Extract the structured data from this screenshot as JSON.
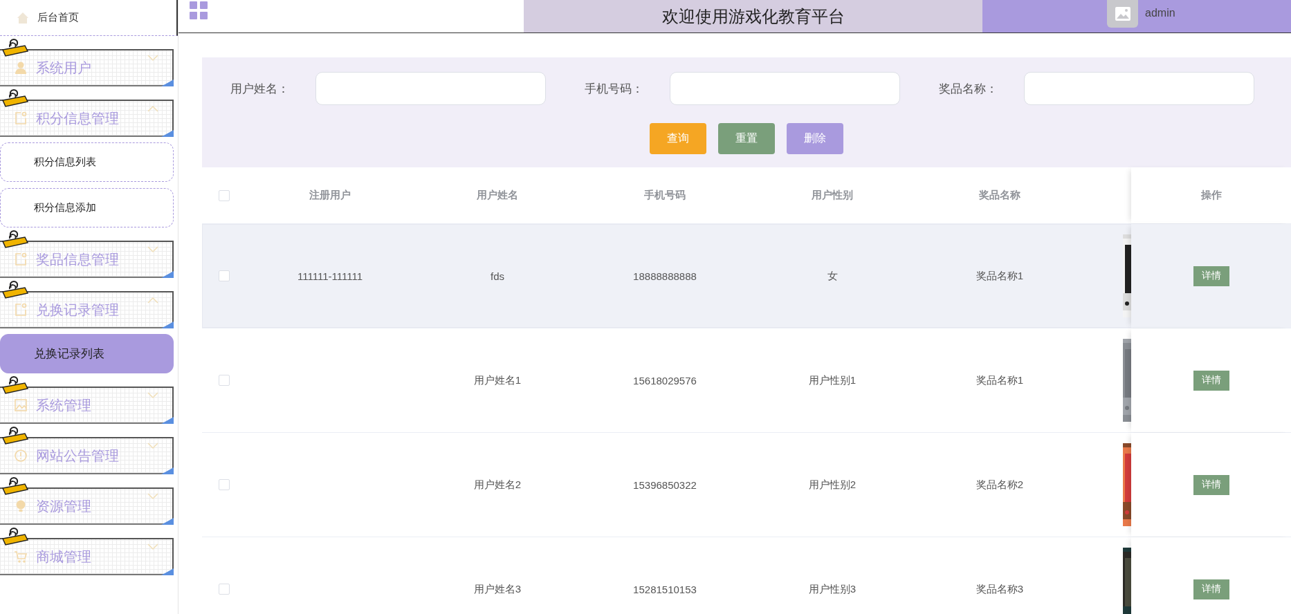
{
  "sidebar": {
    "home": {
      "label": "后台首页"
    },
    "groups": [
      {
        "label": "系统用户",
        "expanded": false
      },
      {
        "label": "积分信息管理",
        "expanded": true,
        "children": [
          {
            "label": "积分信息列表",
            "selected": false
          },
          {
            "label": "积分信息添加",
            "selected": false
          }
        ]
      },
      {
        "label": "奖品信息管理",
        "expanded": false
      },
      {
        "label": "兑换记录管理",
        "expanded": true,
        "children": [
          {
            "label": "兑换记录列表",
            "selected": true
          }
        ]
      },
      {
        "label": "系统管理",
        "expanded": false
      },
      {
        "label": "网站公告管理",
        "expanded": false
      },
      {
        "label": "资源管理",
        "expanded": false
      },
      {
        "label": "商城管理",
        "expanded": false
      }
    ]
  },
  "header": {
    "title": "欢迎使用游戏化教育平台",
    "user": "admin"
  },
  "search": {
    "fields": [
      {
        "label": "用户姓名："
      },
      {
        "label": "手机号码："
      },
      {
        "label": "奖品名称："
      }
    ],
    "buttons": [
      {
        "label": "查询",
        "kind": "search"
      },
      {
        "label": "重置",
        "kind": "reset"
      },
      {
        "label": "删除",
        "kind": "delete"
      }
    ]
  },
  "table": {
    "all_checked": false,
    "columns": [
      "注册用户",
      "用户姓名",
      "手机号码",
      "用户性别",
      "奖品名称"
    ],
    "action_column": "操作",
    "rows": [
      {
        "checked": false,
        "hovered": true,
        "cells": [
          "111111-111111",
          "fds",
          "18888888888",
          "女",
          "奖品名称1"
        ],
        "action": "详情"
      },
      {
        "checked": false,
        "hovered": false,
        "cells": [
          null,
          "用户姓名1",
          "15618029576",
          "用户性别1",
          "奖品名称1"
        ],
        "action": "详情"
      },
      {
        "checked": false,
        "hovered": false,
        "cells": [
          null,
          "用户姓名2",
          "15396850322",
          "用户性别2",
          "奖品名称2"
        ],
        "action": "详情"
      },
      {
        "checked": false,
        "hovered": false,
        "cells": [
          null,
          "用户姓名3",
          "15281510153",
          "用户性别3",
          "奖品名称3"
        ],
        "action": "详情"
      }
    ]
  }
}
